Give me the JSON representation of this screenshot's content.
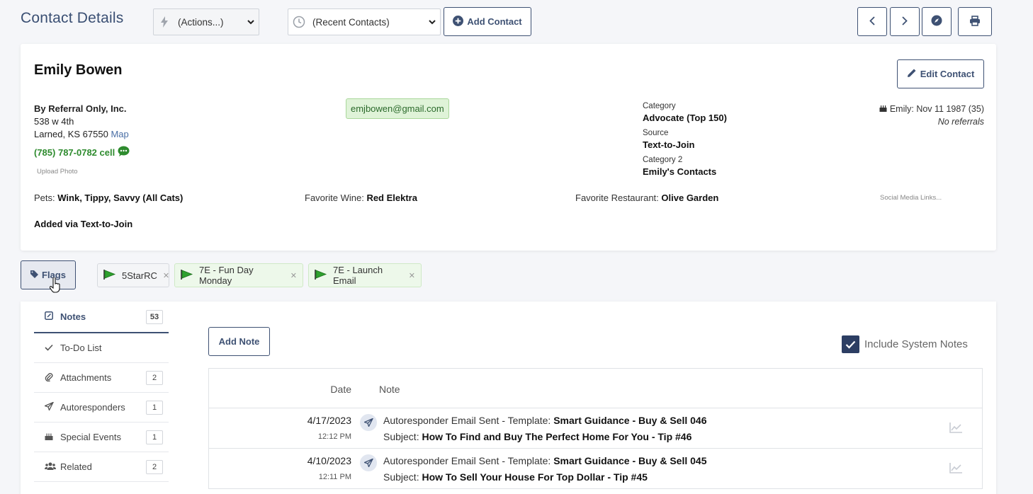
{
  "header": {
    "title": "Contact Details",
    "actions_select": "(Actions...)",
    "recent_select": "(Recent Contacts)",
    "add_contact": "Add Contact"
  },
  "contact": {
    "name": "Emily Bowen",
    "edit_label": "Edit Contact",
    "company": "By Referral Only, Inc.",
    "street": "538 w 4th",
    "city_state": "Larned, KS 67550",
    "map_link": "Map",
    "phone": "(785) 787-0782 cell",
    "upload_photo": "Upload Photo",
    "email": "emjbowen@gmail.com",
    "category_label": "Category",
    "category_value": "Advocate (Top 150)",
    "source_label": "Source",
    "source_value": "Text-to-Join",
    "category2_label": "Category 2",
    "category2_value": "Emily's Contacts",
    "birthday": "Emily: Nov 11 1987 (35)",
    "referrals": "No referrals",
    "pets_label": "Pets:",
    "pets_value": "Wink, Tippy, Savvy (All Cats)",
    "wine_label": "Favorite Wine:",
    "wine_value": "Red Elektra",
    "restaurant_label": "Favorite Restaurant:",
    "restaurant_value": "Olive Garden",
    "social_links": "Social Media Links...",
    "added_via": "Added via Text-to-Join"
  },
  "flags": {
    "button_label": "Flags",
    "items": [
      "5StarRC",
      "7E - Fun Day Monday",
      "7E - Launch Email"
    ],
    "colors": {
      "green_flag": "#2ea02e"
    }
  },
  "sidebar": {
    "items": [
      {
        "label": "Notes",
        "count": "53",
        "icon": "notes-icon"
      },
      {
        "label": "To-Do List",
        "count": "",
        "icon": "check-icon"
      },
      {
        "label": "Attachments",
        "count": "2",
        "icon": "paperclip-icon"
      },
      {
        "label": "Autoresponders",
        "count": "1",
        "icon": "paper-plane-icon"
      },
      {
        "label": "Special Events",
        "count": "1",
        "icon": "cake-icon"
      },
      {
        "label": "Related",
        "count": "2",
        "icon": "users-icon"
      }
    ]
  },
  "notes": {
    "add_note": "Add Note",
    "include_system": "Include System Notes",
    "col_date": "Date",
    "col_note": "Note",
    "rows": [
      {
        "date": "4/17/2023",
        "time": "12:12 PM",
        "line1_prefix": "Autoresponder Email Sent - Template:",
        "line1_bold": "Smart Guidance - Buy & Sell 046",
        "line2_prefix": "Subject:",
        "line2_bold": "How To Find and Buy The Perfect Home For You - Tip #46"
      },
      {
        "date": "4/10/2023",
        "time": "12:11 PM",
        "line1_prefix": "Autoresponder Email Sent - Template:",
        "line1_bold": "Smart Guidance - Buy & Sell 045",
        "line2_prefix": "Subject:",
        "line2_bold": "How To Sell Your House For Top Dollar - Tip #45"
      }
    ]
  }
}
